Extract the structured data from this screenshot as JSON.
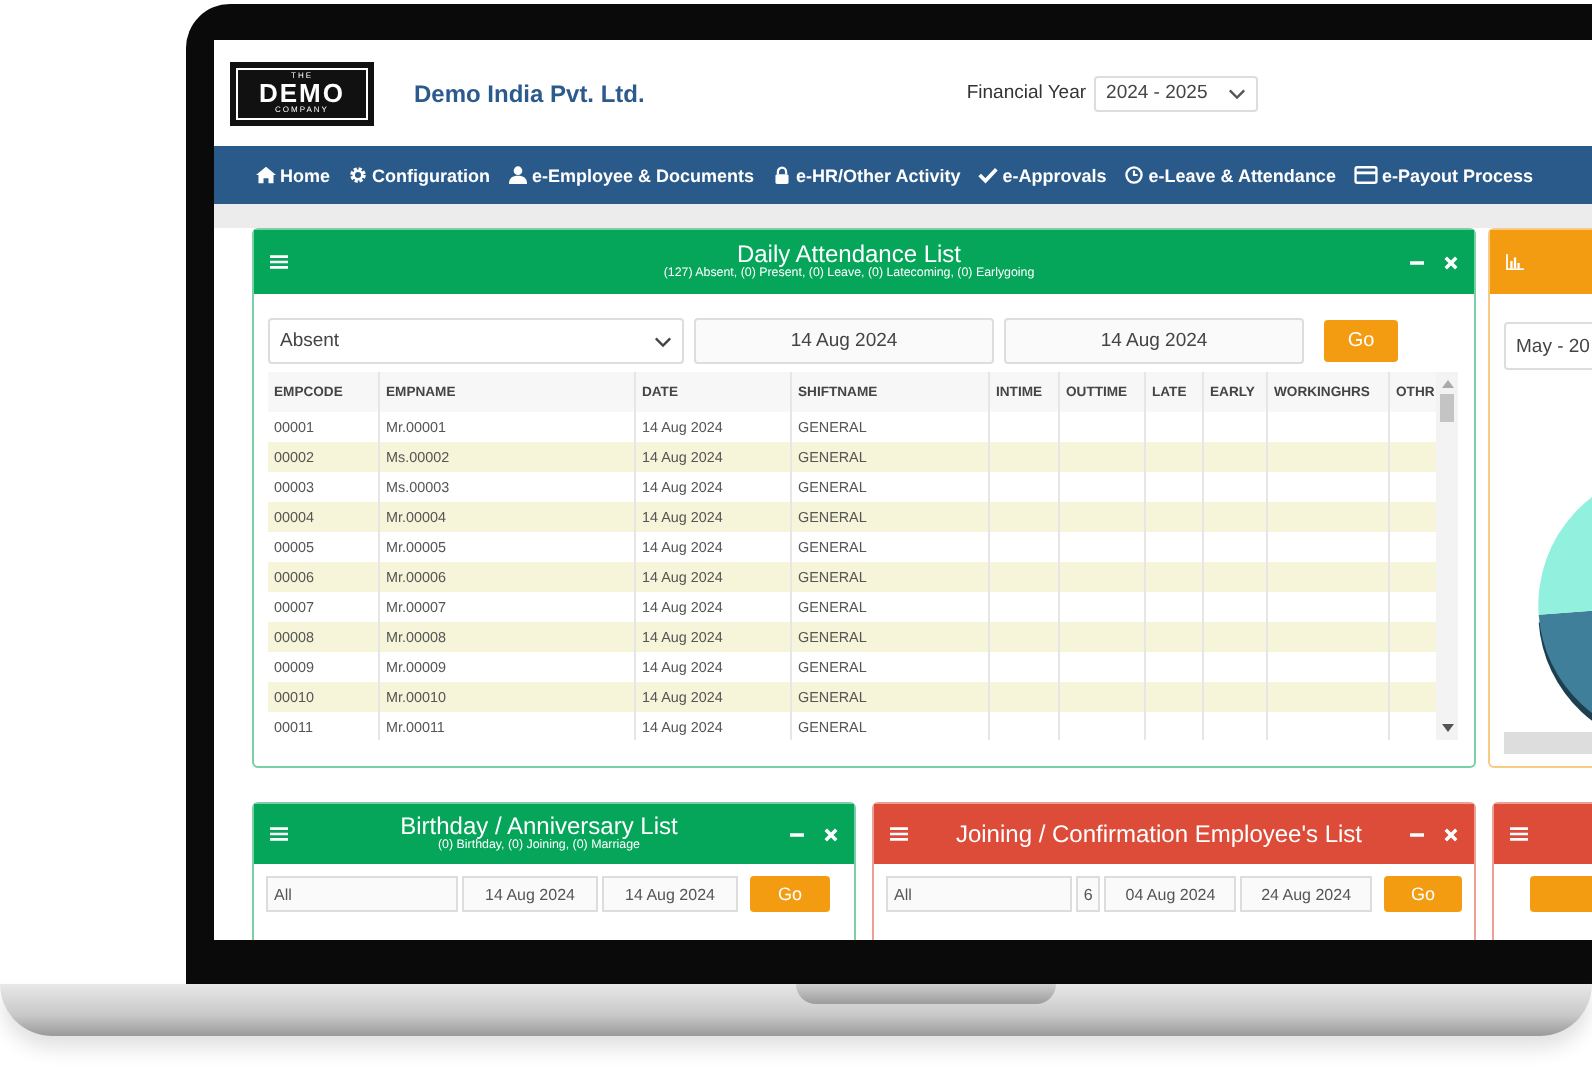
{
  "header": {
    "logo": {
      "top": "THE",
      "main": "DEMO",
      "bottom": "COMPANY"
    },
    "company": "Demo India Pvt. Ltd.",
    "fy_label": "Financial Year",
    "fy_value": "2024 - 2025"
  },
  "nav": [
    {
      "kind": "home",
      "label": "Home"
    },
    {
      "kind": "gear",
      "label": "Configuration"
    },
    {
      "kind": "user",
      "label": "e-Employee & Documents"
    },
    {
      "kind": "lock",
      "label": "e-HR/Other Activity"
    },
    {
      "kind": "check",
      "label": "e-Approvals"
    },
    {
      "kind": "clock",
      "label": "e-Leave & Attendance"
    },
    {
      "kind": "card",
      "label": "e-Payout Process"
    }
  ],
  "attendance": {
    "color": "#05a55a",
    "title": "Daily Attendance List",
    "subtitle": "(127) Absent, (0) Present, (0) Leave, (0) Latecoming, (0) Earlygoing",
    "filter": "Absent",
    "from": "14 Aug 2024",
    "to": "14 Aug 2024",
    "go": "Go",
    "columns": [
      "EMPCODE",
      "EMPNAME",
      "DATE",
      "SHIFTNAME",
      "INTIME",
      "OUTTIME",
      "LATE",
      "EARLY",
      "WORKINGHRS",
      "OTHR"
    ],
    "rows": [
      [
        "00001",
        "Mr.00001",
        "14 Aug 2024",
        "GENERAL"
      ],
      [
        "00002",
        "Ms.00002",
        "14 Aug 2024",
        "GENERAL"
      ],
      [
        "00003",
        "Ms.00003",
        "14 Aug 2024",
        "GENERAL"
      ],
      [
        "00004",
        "Mr.00004",
        "14 Aug 2024",
        "GENERAL"
      ],
      [
        "00005",
        "Mr.00005",
        "14 Aug 2024",
        "GENERAL"
      ],
      [
        "00006",
        "Mr.00006",
        "14 Aug 2024",
        "GENERAL"
      ],
      [
        "00007",
        "Mr.00007",
        "14 Aug 2024",
        "GENERAL"
      ],
      [
        "00008",
        "Mr.00008",
        "14 Aug 2024",
        "GENERAL"
      ],
      [
        "00009",
        "Mr.00009",
        "14 Aug 2024",
        "GENERAL"
      ],
      [
        "00010",
        "Mr.00010",
        "14 Aug 2024",
        "GENERAL"
      ],
      [
        "00011",
        "Mr.00011",
        "14 Aug 2024",
        "GENERAL"
      ]
    ]
  },
  "chart_panel": {
    "color": "#f39c12",
    "select": "May - 20"
  },
  "bottom_panels": [
    {
      "color": "#05a55a",
      "title": "Birthday / Anniversary List",
      "subtitle": "(0) Birthday, (0) Joining, (0) Marriage",
      "fields": [
        {
          "kind": "select",
          "value": "All"
        },
        {
          "kind": "date",
          "value": "14 Aug 2024"
        },
        {
          "kind": "date",
          "value": "14 Aug 2024"
        }
      ],
      "go": "Go"
    },
    {
      "color": "#dd4b39",
      "title": "Joining / Confirmation Employee's List",
      "fields": [
        {
          "kind": "select",
          "value": "All"
        },
        {
          "kind": "small-select",
          "value": "6"
        },
        {
          "kind": "date",
          "value": "04 Aug 2024"
        },
        {
          "kind": "date",
          "value": "24 Aug 2024"
        }
      ],
      "go": "Go"
    },
    {
      "color": "#dd4b39"
    }
  ]
}
